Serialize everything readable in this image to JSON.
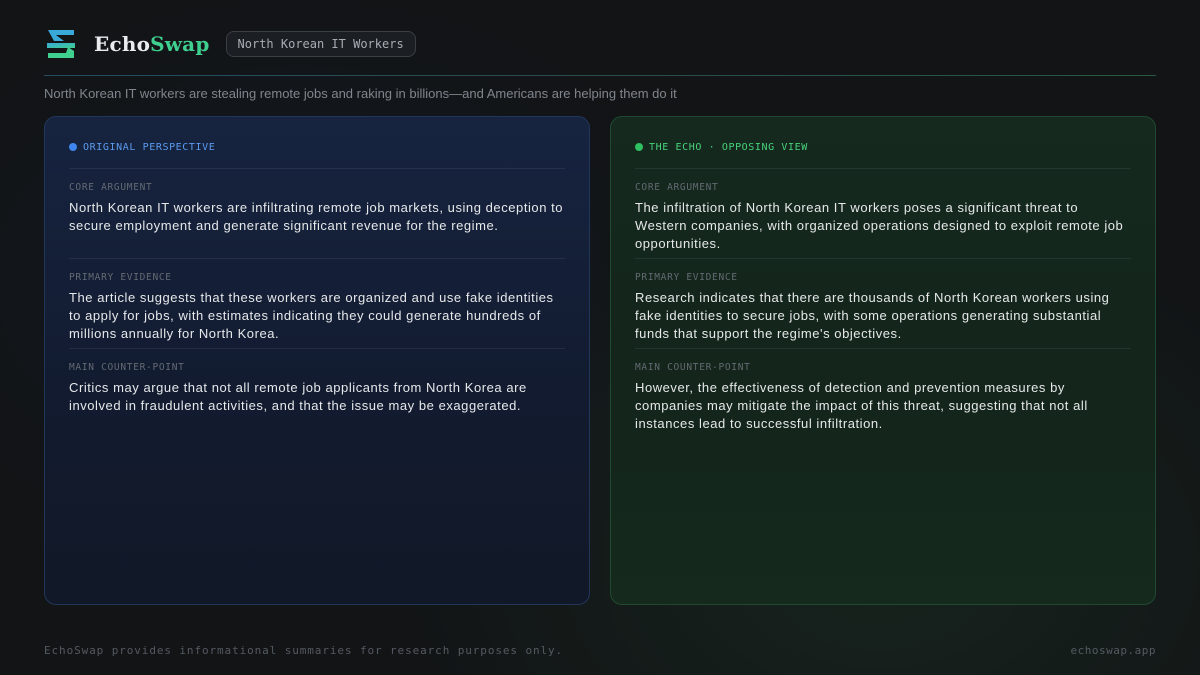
{
  "app": {
    "brand_part1": "Echo",
    "brand_part2": "Swap",
    "logo_icon": "echoswap-logo-icon",
    "accent_color": "#3fcf8e"
  },
  "topic": {
    "pill_label": "North Korean IT Workers"
  },
  "headline": "North Korean IT workers are stealing remote jobs and raking in billions—and Americans are helping them do it",
  "original": {
    "label": "ORIGINAL PERSPECTIVE",
    "accent_color": "#3f86ef",
    "sections": [
      {
        "label": "CORE ARGUMENT",
        "text": "North Korean IT workers are infiltrating remote job markets, using deception to secure employment and generate significant revenue for the regime."
      },
      {
        "label": "PRIMARY EVIDENCE",
        "text": "The article suggests that these workers are organized and use fake identities to apply for jobs, with estimates indicating they could generate hundreds of millions annually for North Korea."
      },
      {
        "label": "MAIN COUNTER-POINT",
        "text": "Critics may argue that not all remote job applicants from North Korea are involved in fraudulent activities, and that the issue may be exaggerated."
      }
    ]
  },
  "echo": {
    "label": "THE ECHO · OPPOSING VIEW",
    "accent_color": "#2ec061",
    "sections": [
      {
        "label": "CORE ARGUMENT",
        "text": "The infiltration of North Korean IT workers poses a significant threat to Western companies, with organized operations designed to exploit remote job opportunities."
      },
      {
        "label": "PRIMARY EVIDENCE",
        "text": "Research indicates that there are thousands of North Korean workers using fake identities to secure jobs, with some operations generating substantial funds that support the regime's objectives."
      },
      {
        "label": "MAIN COUNTER-POINT",
        "text": "However, the effectiveness of detection and prevention measures by companies may mitigate the impact of this threat, suggesting that not all instances lead to successful infiltration."
      }
    ]
  },
  "footer": {
    "disclaimer": "EchoSwap provides informational summaries for research purposes only.",
    "site": "echoswap.app"
  }
}
